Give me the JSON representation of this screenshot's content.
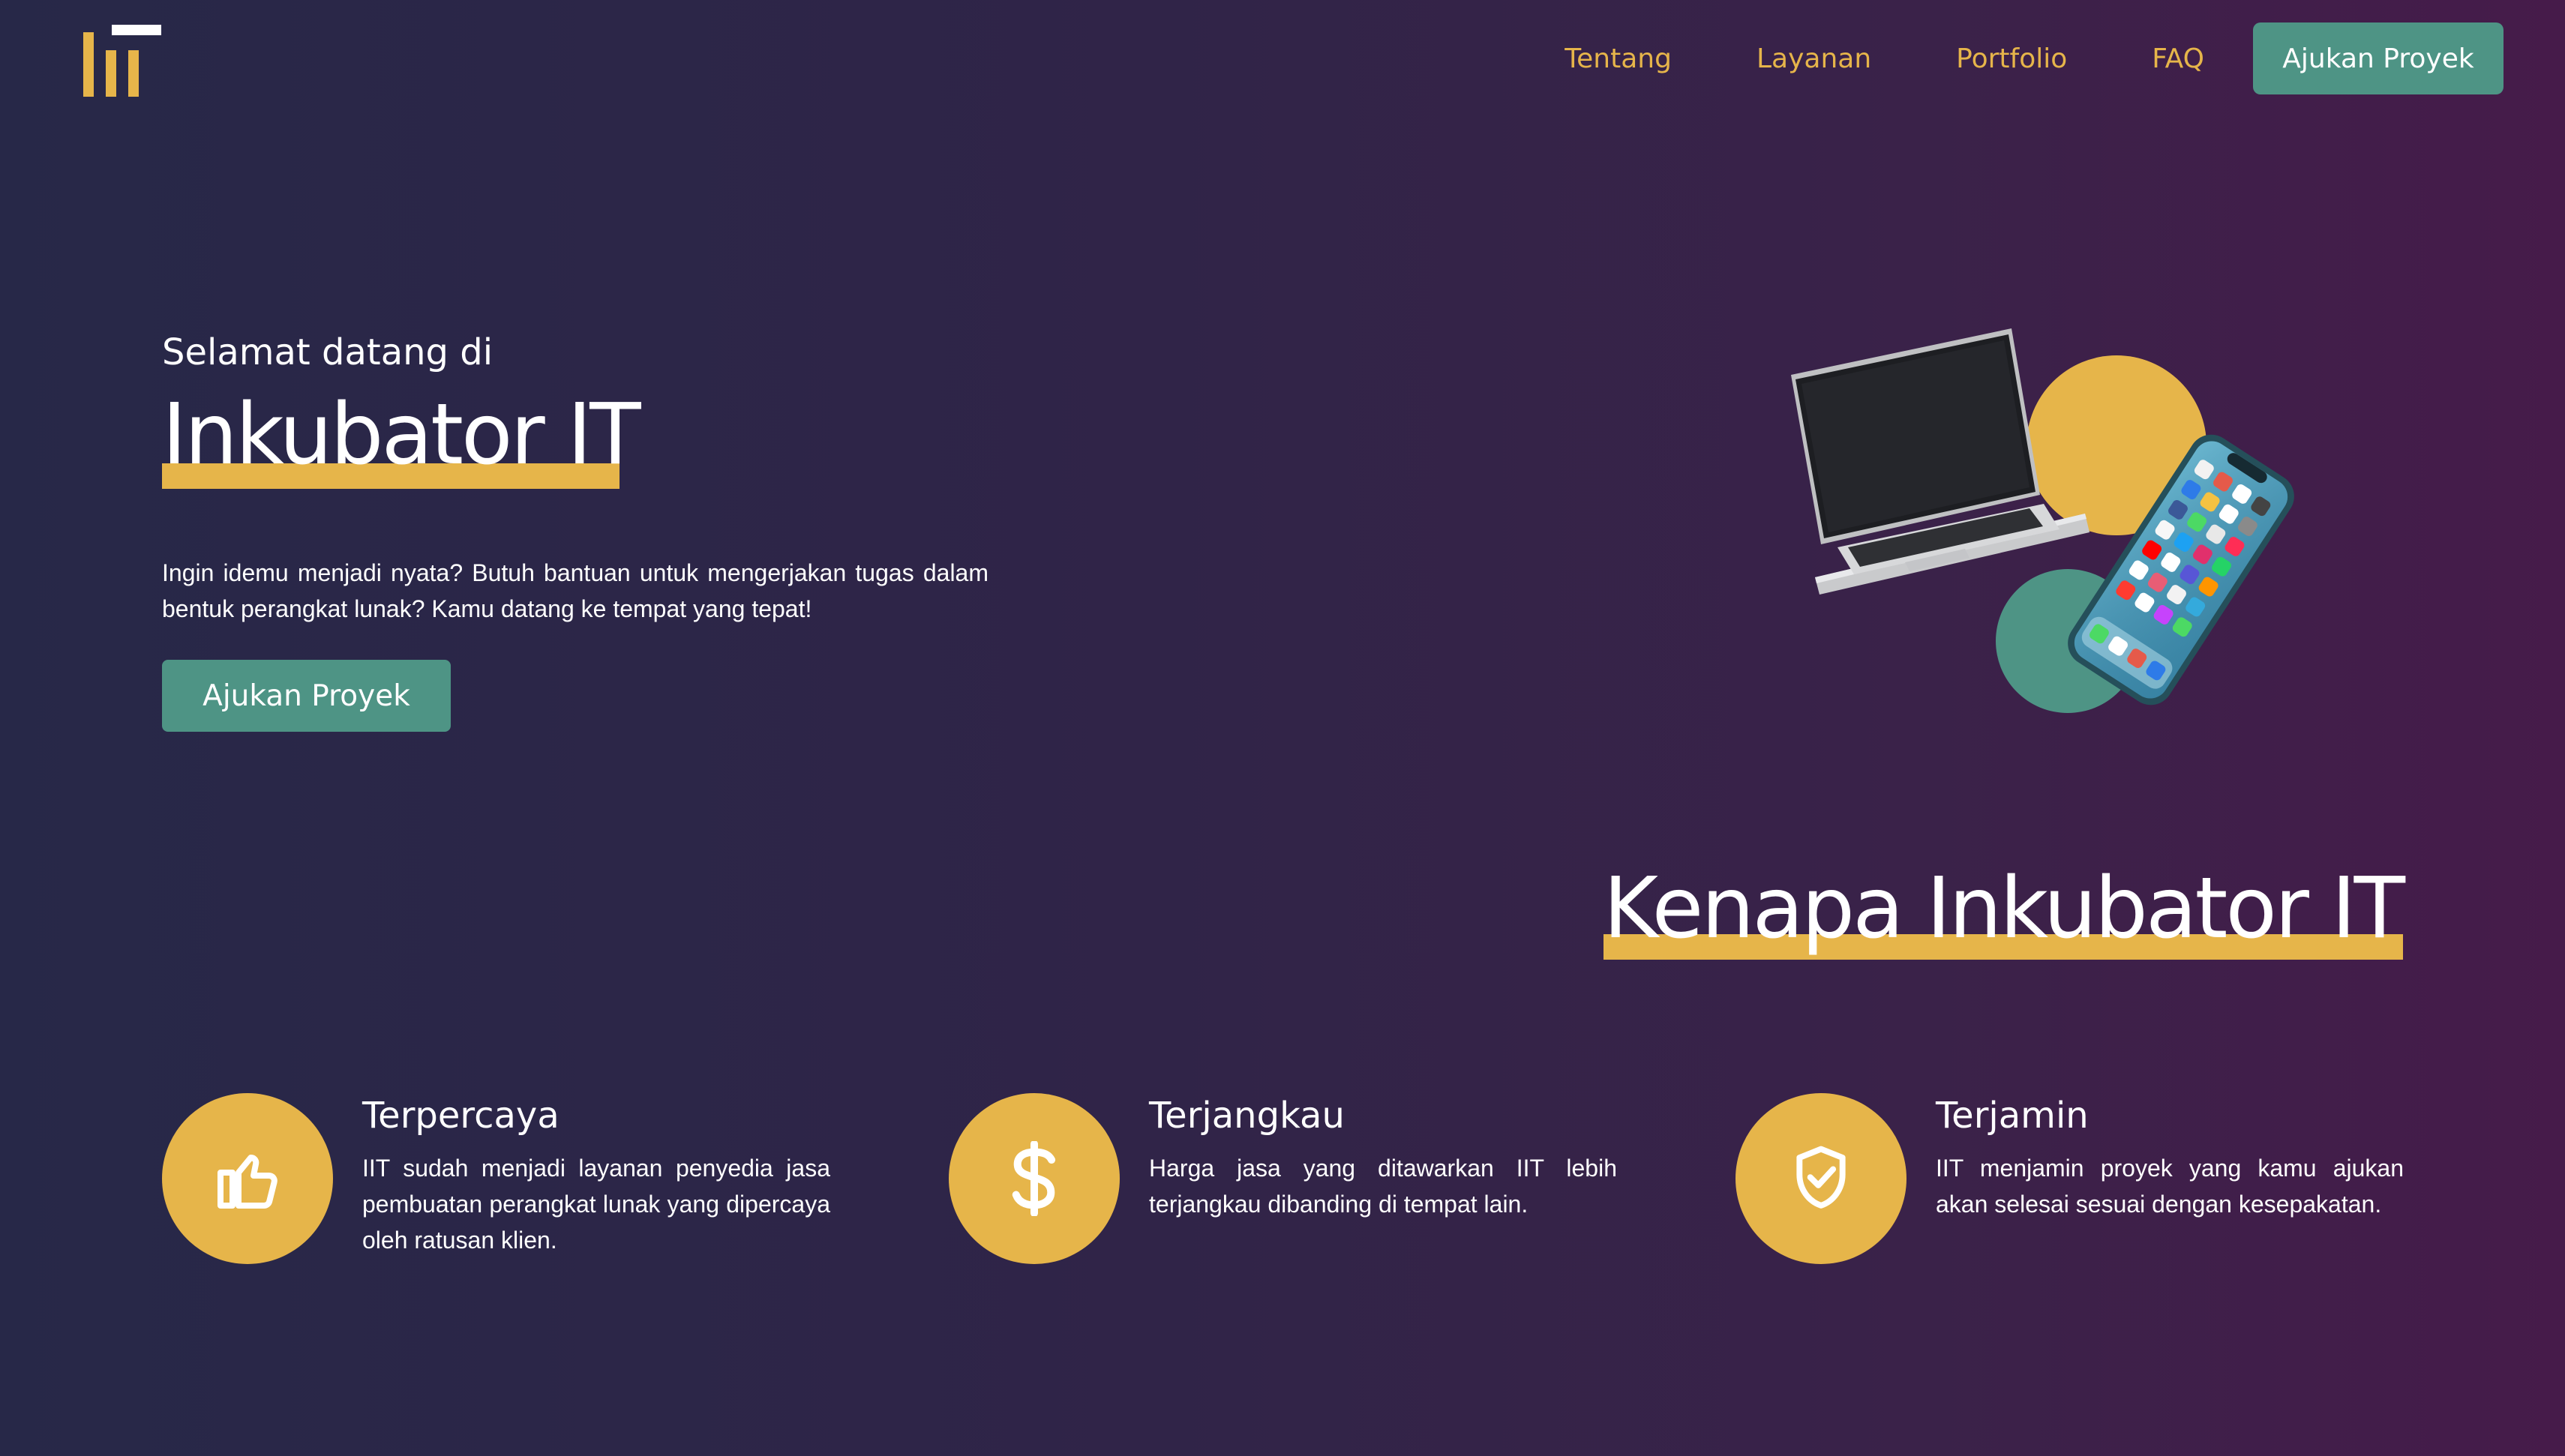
{
  "header": {
    "logo_alt": "IIT",
    "nav": [
      {
        "label": "Tentang"
      },
      {
        "label": "Layanan"
      },
      {
        "label": "Portfolio"
      },
      {
        "label": "FAQ"
      }
    ],
    "cta_label": "Ajukan Proyek"
  },
  "hero": {
    "welcome": "Selamat datang di",
    "title": "Inkubator IT",
    "description": "Ingin idemu menjadi nyata? Butuh bantuan untuk mengerjakan tugas dalam bentuk perangkat lunak? Kamu datang ke tempat yang tepat!",
    "button_label": "Ajukan Proyek"
  },
  "why": {
    "title": "Kenapa Inkubator IT",
    "features": [
      {
        "icon": "thumbs-up-icon",
        "title": "Terpercaya",
        "text": "IIT sudah menjadi layanan penyedia jasa pembuatan perangkat lunak yang dipercaya oleh ratusan klien."
      },
      {
        "icon": "dollar-icon",
        "title": "Terjangkau",
        "text": "Harga jasa yang ditawarkan IIT lebih terjangkau dibanding di tempat lain."
      },
      {
        "icon": "shield-check-icon",
        "title": "Terjamin",
        "text": "IIT menjamin proyek yang kamu ajukan akan selesai sesuai dengan kesepakatan."
      }
    ]
  },
  "colors": {
    "accent_yellow": "#e6b54a",
    "accent_teal": "#4e9485",
    "background_left": "#272848",
    "background_right": "#461b4a"
  }
}
